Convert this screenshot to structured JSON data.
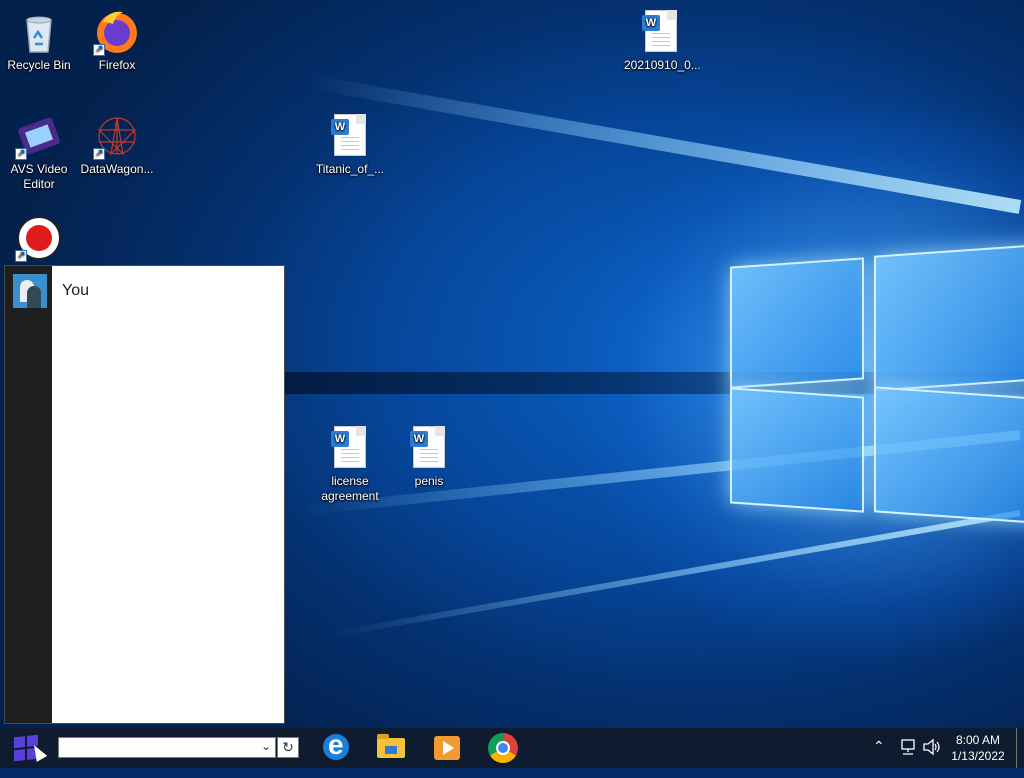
{
  "desktop": {
    "icons": [
      {
        "label": "Recycle Bin",
        "icon": "recycle-bin-icon"
      },
      {
        "label": "Firefox",
        "icon": "firefox-icon"
      },
      {
        "label": "20210910_0...",
        "icon": "word-document-icon"
      },
      {
        "label": "AVS Video Editor",
        "icon": "avs-video-editor-icon"
      },
      {
        "label": "DataWagon...",
        "icon": "datawagon-icon"
      },
      {
        "label": "Titanic_of_...",
        "icon": "word-document-icon"
      },
      {
        "label": "",
        "icon": "record-icon"
      },
      {
        "label": "license agreement",
        "icon": "word-document-icon"
      },
      {
        "label": "penis",
        "icon": "word-document-icon"
      }
    ]
  },
  "start_menu": {
    "user_name": "You"
  },
  "taskbar": {
    "search_value": "",
    "pinned": [
      "edge-icon",
      "file-explorer-icon",
      "media-player-icon",
      "chrome-icon"
    ],
    "tray_icons": [
      "chevron-up-icon",
      "network-icon",
      "volume-icon"
    ],
    "time": "8:00 AM",
    "date": "1/13/2022"
  },
  "colors": {
    "taskbar": "#0f1b2e",
    "start_rail": "#1f1f1f",
    "start_logo": "#5a3fd8"
  }
}
